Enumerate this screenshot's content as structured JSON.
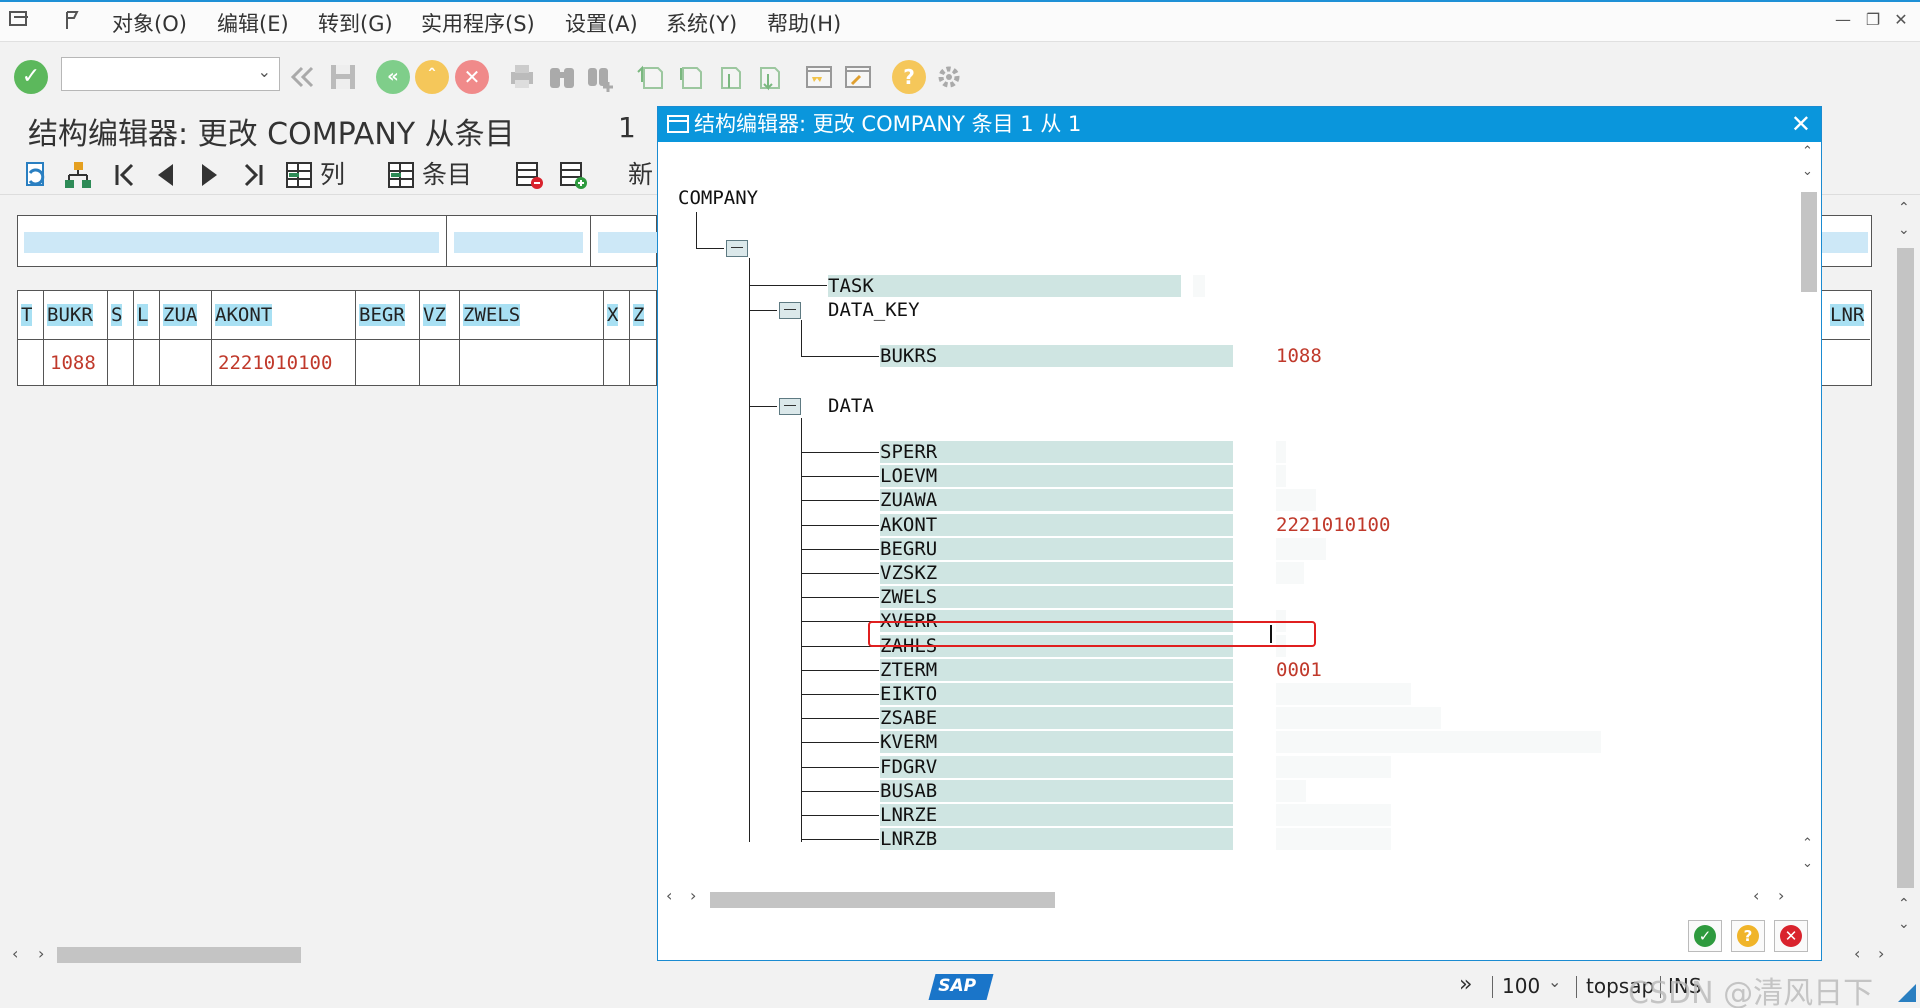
{
  "menubar": {
    "items": [
      "对象(O)",
      "编辑(E)",
      "转到(G)",
      "实用程序(S)",
      "设置(A)",
      "系统(Y)",
      "帮助(H)"
    ]
  },
  "toolbar": {
    "command_field_value": ""
  },
  "screen": {
    "title": "结构编辑器: 更改 COMPANY 从条目",
    "count": "1"
  },
  "app_toolbar": {
    "column_label": "列",
    "entry_label": "条目",
    "new_label": "新"
  },
  "left_table": {
    "columns": [
      "T",
      "BUKR",
      "S",
      "L",
      "ZUA",
      "AKONT",
      "BEGR",
      "VZ",
      "ZWELS",
      "X",
      "Z"
    ],
    "row": [
      "",
      "1088",
      "",
      "",
      "",
      "2221010100",
      "",
      "",
      "",
      "",
      ""
    ]
  },
  "right_edge": {
    "column": "LNR"
  },
  "dialog": {
    "title": "结构编辑器: 更改 COMPANY 条目 1 从 1",
    "root": "COMPANY",
    "task_label": "TASK",
    "data_key_label": "DATA_KEY",
    "bukrs": {
      "name": "BUKRS",
      "value": "1088"
    },
    "data_label": "DATA",
    "fields": [
      {
        "name": "SPERR",
        "value": ""
      },
      {
        "name": "LOEVM",
        "value": ""
      },
      {
        "name": "ZUAWA",
        "value": ""
      },
      {
        "name": "AKONT",
        "value": "2221010100"
      },
      {
        "name": "BEGRU",
        "value": ""
      },
      {
        "name": "VZSKZ",
        "value": ""
      },
      {
        "name": "ZWELS",
        "value": ""
      },
      {
        "name": "XVERR",
        "value": ""
      },
      {
        "name": "ZAHLS",
        "value": ""
      },
      {
        "name": "ZTERM",
        "value": "0001"
      },
      {
        "name": "EIKTO",
        "value": ""
      },
      {
        "name": "ZSABE",
        "value": ""
      },
      {
        "name": "KVERM",
        "value": ""
      },
      {
        "name": "FDGRV",
        "value": ""
      },
      {
        "name": "BUSAB",
        "value": ""
      },
      {
        "name": "LNRZE",
        "value": ""
      },
      {
        "name": "LNRZB",
        "value": ""
      }
    ]
  },
  "statusbar": {
    "zoom": "100",
    "system": "topsap",
    "mode": "INS",
    "watermark": "CSDN @清风日下"
  },
  "colors": {
    "title_bar": "#0a96dc",
    "value_red": "#c0392b",
    "focus_red": "#e01f1f",
    "field_bar": "#cfe5e2",
    "header_highlight": "#a8e0f3"
  }
}
